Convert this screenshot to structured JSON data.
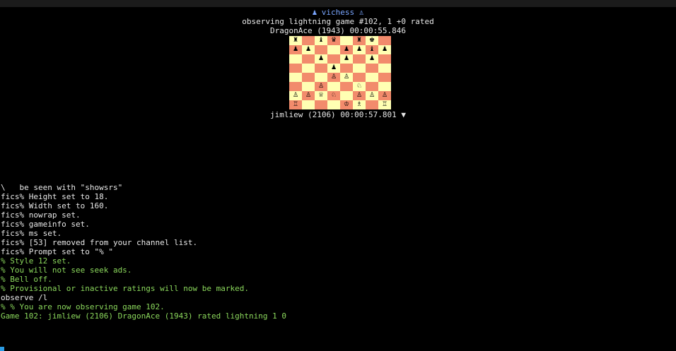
{
  "header": {
    "title": "♟ vichess ♙",
    "game_line": "observing lightning game #102, 1 +0 rated",
    "top_player": "DragonAce (1943) 00:00:55.846",
    "bottom_player": "jimliew (2106) 00:00:57.801 ▼"
  },
  "board": {
    "light_color": "#ffffb3",
    "dark_color": "#f28b6c",
    "ranks": [
      [
        "♜",
        "",
        "♝",
        "♛",
        "",
        "♜",
        "♚",
        ""
      ],
      [
        "♟",
        "♟",
        "",
        "",
        "♟",
        "♟",
        "♝",
        "♟"
      ],
      [
        "",
        "",
        "♟",
        "",
        "♟",
        "",
        "♟",
        ""
      ],
      [
        "",
        "",
        "",
        "♟",
        "",
        "",
        "",
        ""
      ],
      [
        "",
        "",
        "",
        "♙",
        "♙",
        "",
        "",
        ""
      ],
      [
        "",
        "",
        "♙",
        "",
        "",
        "♘",
        "",
        ""
      ],
      [
        "♙",
        "♙",
        "♕",
        "♘",
        "",
        "♙",
        "♙",
        "♙"
      ],
      [
        "♖",
        "",
        "",
        "",
        "♔",
        "♗",
        "",
        "♖"
      ]
    ]
  },
  "console": {
    "lines": [
      {
        "text": "\\   be seen with \"showsrs\"",
        "color": "white"
      },
      {
        "text": "fics% Height set to 18.",
        "color": "white"
      },
      {
        "text": "fics% Width set to 160.",
        "color": "white"
      },
      {
        "text": "fics% nowrap set.",
        "color": "white"
      },
      {
        "text": "fics% gameinfo set.",
        "color": "white"
      },
      {
        "text": "fics% ms set.",
        "color": "white"
      },
      {
        "text": "fics% [53] removed from your channel list.",
        "color": "white"
      },
      {
        "text": "fics% Prompt set to \"% \"",
        "color": "white"
      },
      {
        "text": "% Style 12 set.",
        "color": "green"
      },
      {
        "text": "% You will not see seek ads.",
        "color": "green"
      },
      {
        "text": "% Bell off.",
        "color": "green"
      },
      {
        "text": "% Provisional or inactive ratings will now be marked.",
        "color": "green"
      },
      {
        "text": "observe /l",
        "color": "white"
      },
      {
        "text": "% % You are now observing game 102.",
        "color": "green"
      },
      {
        "text": "Game 102: jimliew (2106) DragonAce (1943) rated lightning 1 0",
        "color": "green"
      }
    ]
  }
}
